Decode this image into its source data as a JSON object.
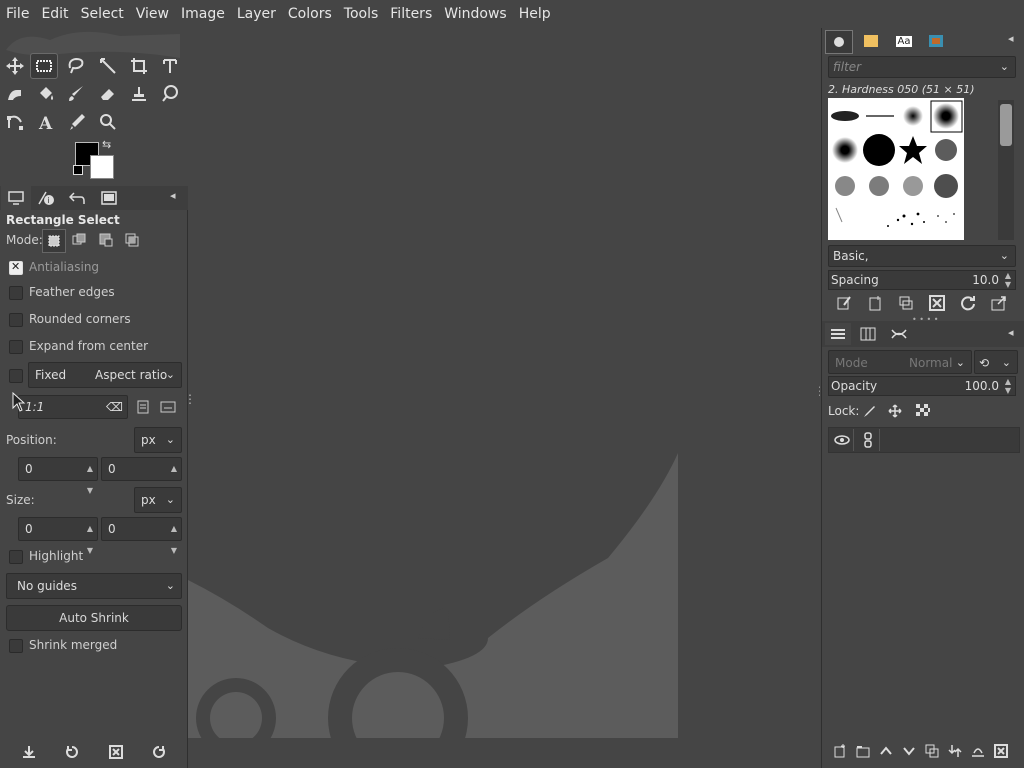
{
  "menu": [
    "File",
    "Edit",
    "Select",
    "View",
    "Image",
    "Layer",
    "Colors",
    "Tools",
    "Filters",
    "Windows",
    "Help"
  ],
  "tool_options": {
    "title": "Rectangle Select",
    "mode_label": "Mode:",
    "antialiasing": "Antialiasing",
    "feather_edges": "Feather edges",
    "rounded_corners": "Rounded corners",
    "expand_from_center": "Expand from center",
    "fixed": "Fixed",
    "aspect_ratio": "Aspect ratio",
    "ratio_value": "1:1",
    "position_label": "Position:",
    "position_unit": "px",
    "position_x": "0",
    "position_y": "0",
    "size_label": "Size:",
    "size_unit": "px",
    "size_w": "0",
    "size_h": "0",
    "highlight": "Highlight",
    "guides": "No guides",
    "auto_shrink": "Auto Shrink",
    "shrink_merged": "Shrink merged"
  },
  "brushes": {
    "filter_placeholder": "filter",
    "selected_brush": "2. Hardness 050 (51 × 51)",
    "preset": "Basic,",
    "spacing_label": "Spacing",
    "spacing_value": "10.0"
  },
  "layers": {
    "mode_label": "Mode",
    "mode_value": "Normal",
    "opacity_label": "Opacity",
    "opacity_value": "100.0",
    "lock_label": "Lock:"
  },
  "colors": {
    "foreground": "#000000",
    "background": "#ffffff",
    "wilber_shape": "#5c5c5c"
  }
}
